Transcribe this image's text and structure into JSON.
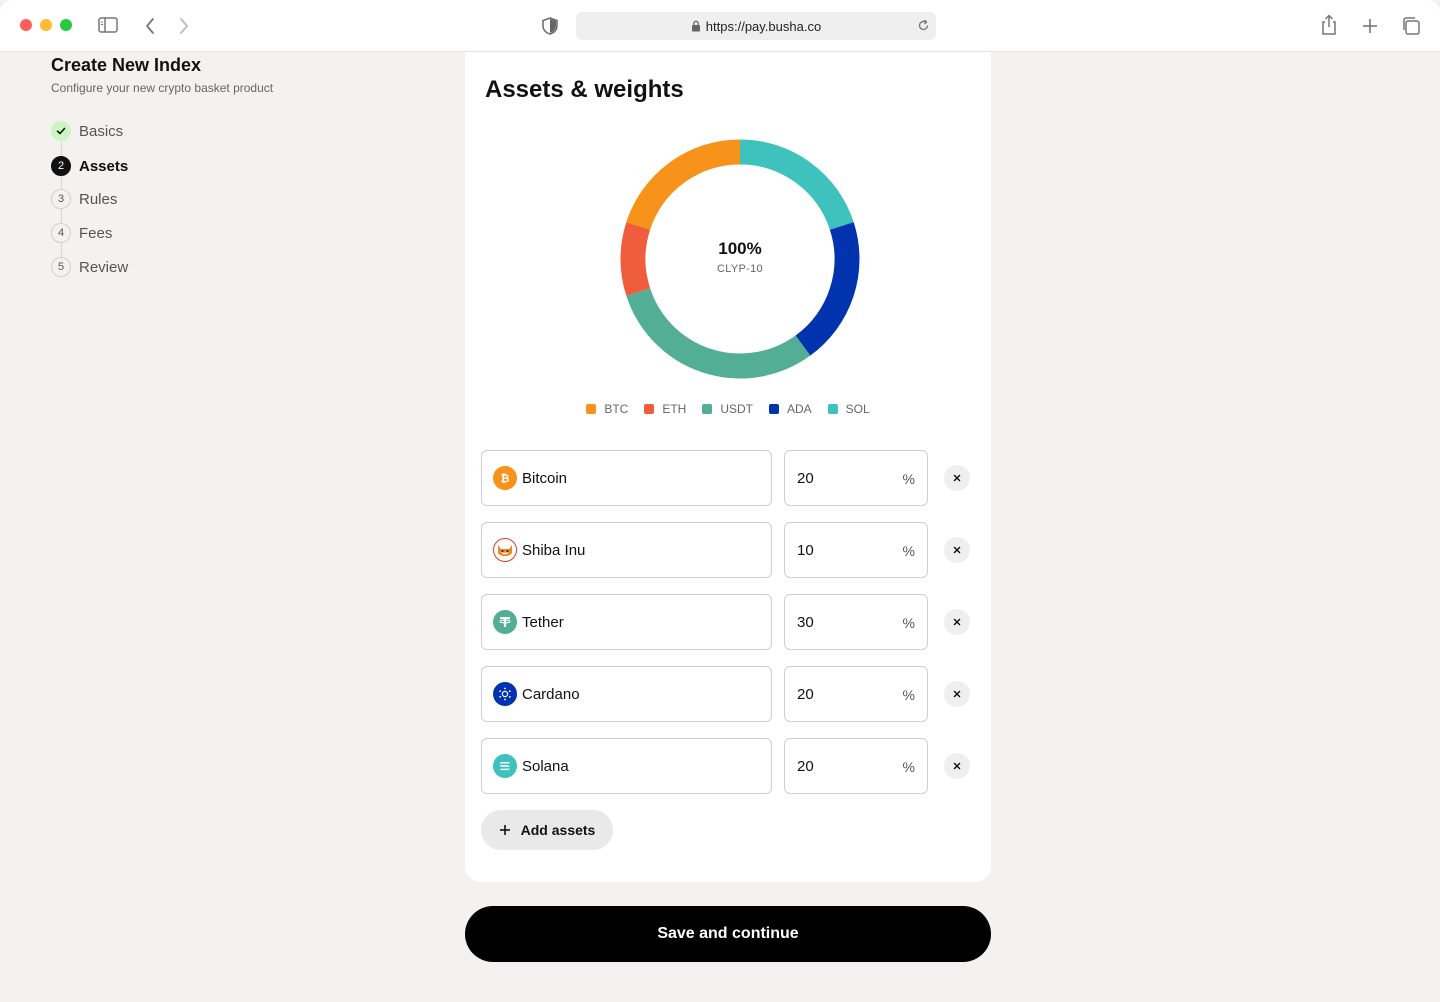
{
  "browser": {
    "url": "https://pay.busha.co"
  },
  "sidebar": {
    "title": "Create New Index",
    "subtitle": "Configure your new crypto basket product",
    "steps": [
      {
        "number": "1",
        "label": "Basics",
        "status": "done"
      },
      {
        "number": "2",
        "label": "Assets",
        "status": "active"
      },
      {
        "number": "3",
        "label": "Rules",
        "status": "pending"
      },
      {
        "number": "4",
        "label": "Fees",
        "status": "pending"
      },
      {
        "number": "5",
        "label": "Review",
        "status": "pending"
      }
    ]
  },
  "card": {
    "title": "Assets & weights",
    "donut": {
      "total_label": "100%",
      "index_name": "CLYP-10"
    },
    "legend": [
      {
        "label": "BTC",
        "color": "#f7931a"
      },
      {
        "label": "ETH",
        "color": "#f05c3e"
      },
      {
        "label": "USDT",
        "color": "#52ae94"
      },
      {
        "label": "ADA",
        "color": "#0033ad"
      },
      {
        "label": "SOL",
        "color": "#3fc1be"
      }
    ],
    "assets": [
      {
        "name": "Bitcoin",
        "weight": "20",
        "unit": "%",
        "icon": "bitcoin-icon"
      },
      {
        "name": "Shiba Inu",
        "weight": "10",
        "unit": "%",
        "icon": "shiba-inu-icon"
      },
      {
        "name": "Tether",
        "weight": "30",
        "unit": "%",
        "icon": "tether-icon"
      },
      {
        "name": "Cardano",
        "weight": "20",
        "unit": "%",
        "icon": "cardano-icon"
      },
      {
        "name": "Solana",
        "weight": "20",
        "unit": "%",
        "icon": "solana-icon"
      }
    ],
    "add_label": "Add assets"
  },
  "save_label": "Save and continue",
  "chart_data": {
    "type": "pie",
    "categories": [
      "SOL",
      "ADA",
      "USDT",
      "ETH",
      "BTC"
    ],
    "values": [
      20,
      20,
      30,
      10,
      20
    ],
    "colors": [
      "#3fc1be",
      "#0033ad",
      "#52ae94",
      "#f05c3e",
      "#f7931a"
    ],
    "legend": [
      "BTC",
      "ETH",
      "USDT",
      "ADA",
      "SOL"
    ],
    "title": "",
    "center_label": "100%",
    "center_sublabel": "CLYP-10"
  }
}
